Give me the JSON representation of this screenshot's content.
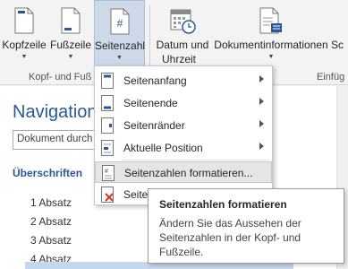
{
  "ribbon": {
    "buttons": [
      {
        "label": "Kopfzeile",
        "icon": "header-page-icon"
      },
      {
        "label": "Fußzeile",
        "icon": "footer-page-icon"
      },
      {
        "label": "Seitenzahl",
        "icon": "page-number-icon",
        "glyph": "#"
      },
      {
        "label": "Datum und",
        "label2": "Uhrzeit",
        "icon": "calendar-clock-icon"
      },
      {
        "label": "Dokumentinformationen",
        "icon": "document-info-icon"
      },
      {
        "label": "Sc",
        "icon": "quick-parts-icon"
      }
    ],
    "groups": {
      "header_footer": "Kopf- und Fuß",
      "insert": "Einfüg"
    }
  },
  "navigation": {
    "title": "Navigation",
    "search_placeholder": "Dokument durch",
    "tab": "Überschriften",
    "items": [
      "1 Absatz",
      "2 Absatz",
      "3 Absatz",
      "4 Absatz"
    ]
  },
  "menu": {
    "items": [
      {
        "label": "Seitenanfang",
        "mnemonic": "a",
        "submenu": true
      },
      {
        "label": "Seitenende",
        "mnemonic": "d",
        "submenu": true
      },
      {
        "label": "Seitenränder",
        "mnemonic": "r",
        "submenu": true
      },
      {
        "label": "Aktuelle Position",
        "mnemonic": "A",
        "submenu": true
      },
      {
        "label": "Seitenzahlen formatieren...",
        "mnemonic": "f",
        "submenu": false,
        "highlighted": true
      },
      {
        "label": "Seitenzahlen entfernen",
        "submenu": false
      }
    ],
    "visible_partial_label": "Seitenz"
  },
  "tooltip": {
    "title": "Seitenzahlen formatieren",
    "body": "Ändern Sie das Aussehen der Seitenzahlen in der Kopf- und Fußzeile."
  },
  "colors": {
    "accent": "#2b579a",
    "active_button": "#cdd9e8",
    "menu_hover": "#e5e5e5",
    "remove_icon": "#d9342b"
  }
}
